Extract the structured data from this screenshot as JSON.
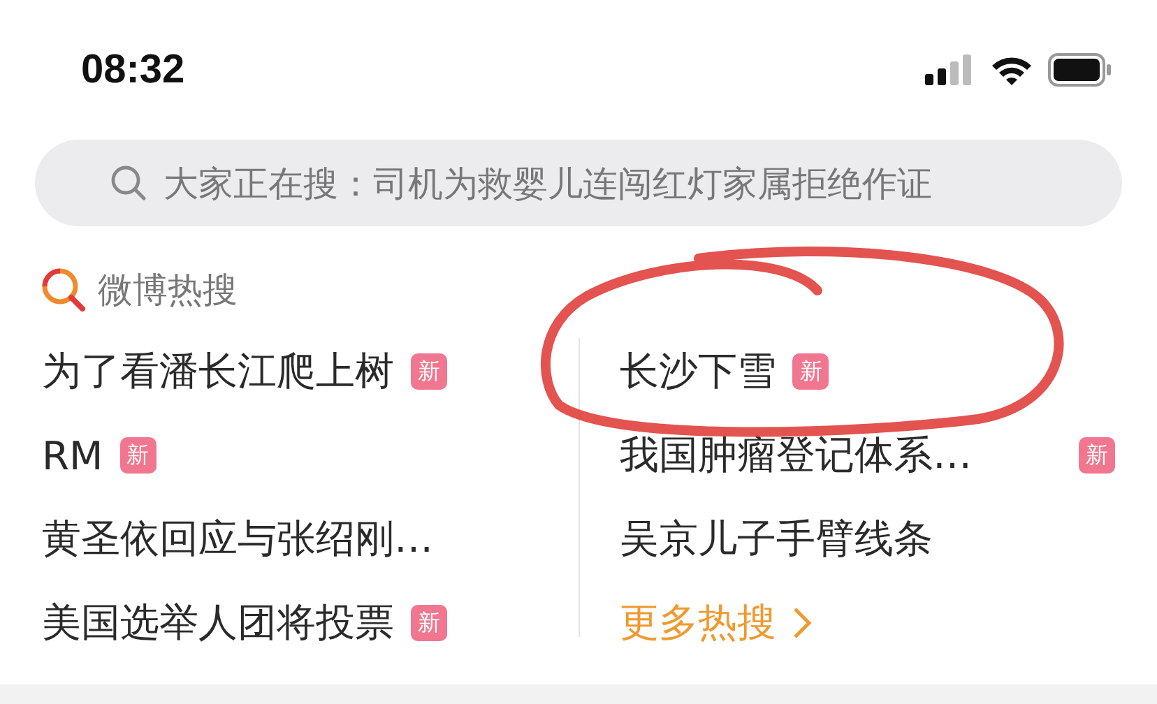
{
  "status_bar": {
    "time": "08:32"
  },
  "search": {
    "placeholder": "大家正在搜：司机为救婴儿连闯红灯家属拒绝作证"
  },
  "hot_search": {
    "title": "微博热搜",
    "columns": [
      [
        {
          "text": "为了看潘长江爬上树",
          "badge": "新"
        },
        {
          "text": "RM",
          "badge": "新"
        },
        {
          "text": "黄圣依回应与张绍刚…"
        },
        {
          "text": "美国选举人团将投票",
          "badge": "新"
        }
      ],
      [
        {
          "text": "长沙下雪",
          "badge": "新"
        },
        {
          "text": "我国肿瘤登记体系…",
          "badge": "新",
          "badge_far": true
        },
        {
          "text": "吴京儿子手臂线条"
        }
      ]
    ],
    "more_link": "更多热搜"
  },
  "annotation": {
    "kind": "circle"
  }
}
